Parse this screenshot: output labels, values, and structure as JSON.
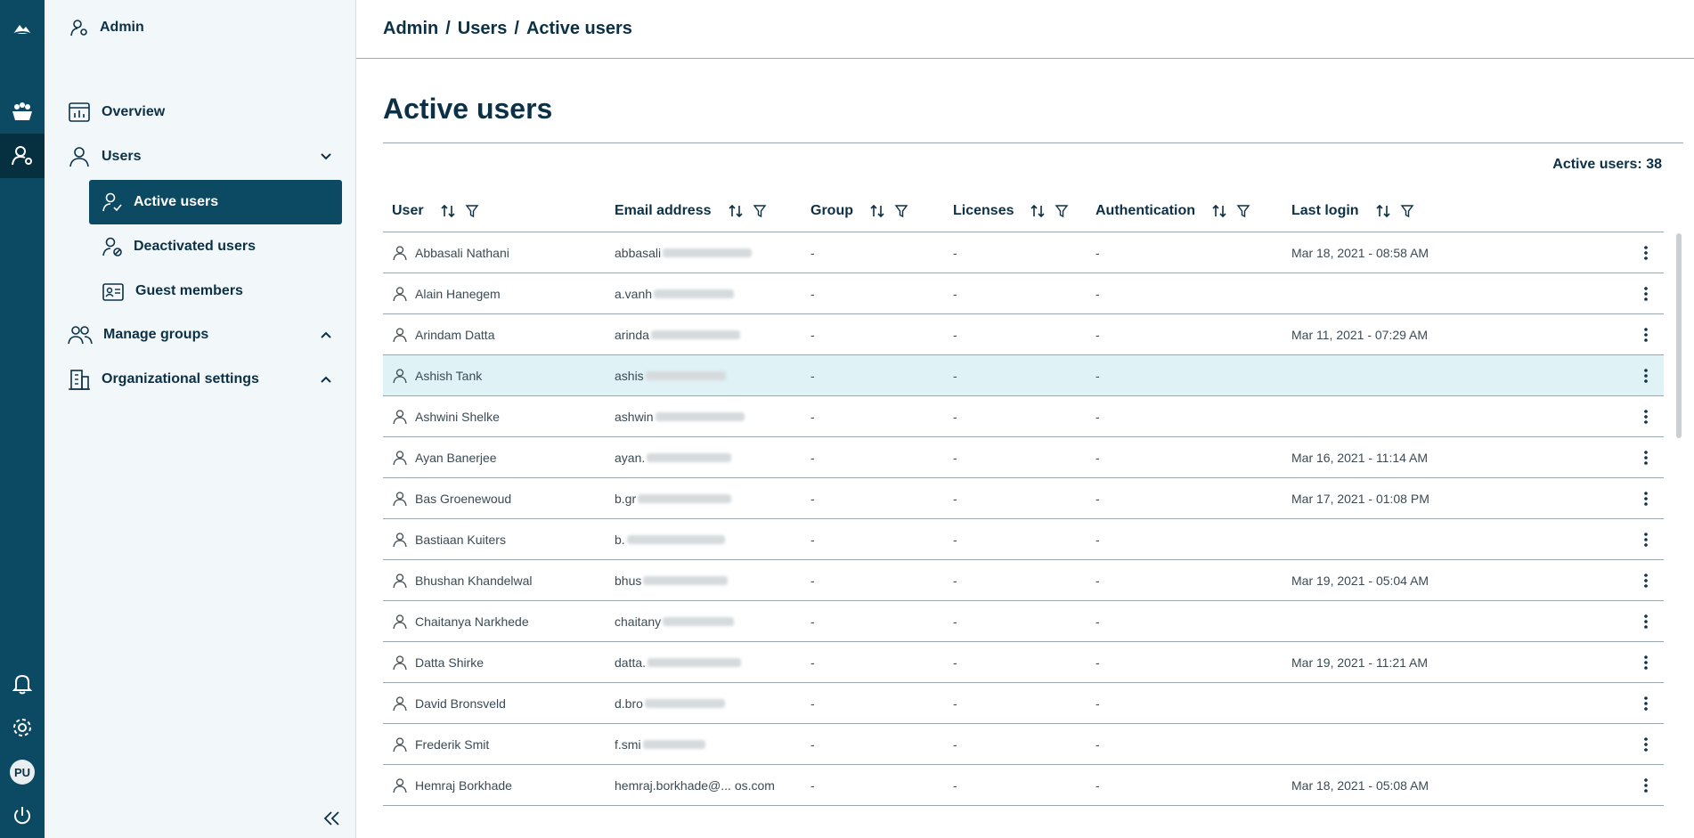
{
  "rail": {
    "icons": [
      "cloud-logo-icon",
      "marketplace-icon",
      "admin-icon",
      "bell-icon",
      "gear-icon",
      "power-icon"
    ],
    "avatar_initials": "PU"
  },
  "sidebar": {
    "admin_label": "Admin",
    "overview": "Overview",
    "users": "Users",
    "sub": {
      "active": "Active users",
      "deactivated": "Deactivated users",
      "guest": "Guest members"
    },
    "manage_groups": "Manage groups",
    "org_settings": "Organizational settings"
  },
  "breadcrumb": {
    "a": "Admin",
    "b": "Users",
    "c": "Active users",
    "sep": "/"
  },
  "page_title": "Active users",
  "count_label": "Active users: 38",
  "table": {
    "headers": {
      "user": "User",
      "email": "Email address",
      "group": "Group",
      "licenses": "Licenses",
      "auth": "Authentication",
      "last_login": "Last login"
    },
    "rows": [
      {
        "name": "Abbasali Nathani",
        "email": "abbasali",
        "group": "-",
        "licenses": "-",
        "auth": "-",
        "last_login": "Mar 18, 2021 - 08:58 AM"
      },
      {
        "name": "Alain Hanegem",
        "email": "a.vanh",
        "group": "-",
        "licenses": "-",
        "auth": "-",
        "last_login": ""
      },
      {
        "name": "Arindam Datta",
        "email": "arinda",
        "group": "-",
        "licenses": "-",
        "auth": "-",
        "last_login": "Mar 11, 2021 - 07:29 AM"
      },
      {
        "name": "Ashish Tank",
        "email": "ashis",
        "group": "-",
        "licenses": "-",
        "auth": "-",
        "last_login": ""
      },
      {
        "name": "Ashwini Shelke",
        "email": "ashwin",
        "group": "-",
        "licenses": "-",
        "auth": "-",
        "last_login": ""
      },
      {
        "name": "Ayan Banerjee",
        "email": "ayan.",
        "group": "-",
        "licenses": "-",
        "auth": "-",
        "last_login": "Mar 16, 2021 - 11:14 AM"
      },
      {
        "name": "Bas Groenewoud",
        "email": "b.gr",
        "group": "-",
        "licenses": "-",
        "auth": "-",
        "last_login": "Mar 17, 2021 - 01:08 PM"
      },
      {
        "name": "Bastiaan Kuiters",
        "email": "b.",
        "group": "-",
        "licenses": "-",
        "auth": "-",
        "last_login": ""
      },
      {
        "name": "Bhushan Khandelwal",
        "email": "bhus",
        "group": "-",
        "licenses": "-",
        "auth": "-",
        "last_login": "Mar 19, 2021 - 05:04 AM"
      },
      {
        "name": "Chaitanya Narkhede",
        "email": "chaitany",
        "group": "-",
        "licenses": "-",
        "auth": "-",
        "last_login": ""
      },
      {
        "name": "Datta Shirke",
        "email": "datta.",
        "group": "-",
        "licenses": "-",
        "auth": "-",
        "last_login": "Mar 19, 2021 - 11:21 AM"
      },
      {
        "name": "David Bronsveld",
        "email": "d.bro",
        "group": "-",
        "licenses": "-",
        "auth": "-",
        "last_login": ""
      },
      {
        "name": "Frederik Smit",
        "email": "f.smi",
        "group": "-",
        "licenses": "-",
        "auth": "-",
        "last_login": ""
      },
      {
        "name": "Hemraj Borkhade",
        "email": "hemraj.borkhade@... os.com",
        "group": "-",
        "licenses": "-",
        "auth": "-",
        "last_login": "Mar 18, 2021 - 05:08 AM"
      }
    ]
  },
  "colors": {
    "rail": "#0c4a63",
    "active_nav": "#0c4a63",
    "highlight_row": "#dff2f6",
    "text": "#0c3146"
  }
}
